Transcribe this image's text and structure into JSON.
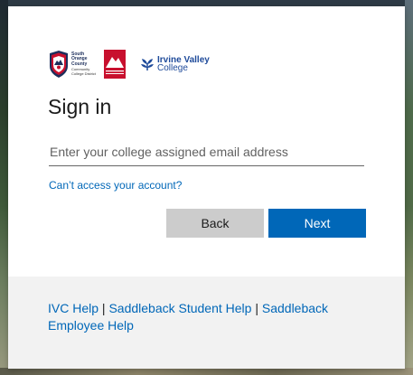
{
  "logos": {
    "socccd": {
      "line1": "South",
      "line2": "Orange",
      "line3": "County",
      "sub1": "Community",
      "sub2": "College District"
    },
    "saddleback": {
      "text": "SADDLEBACK COLLEGE"
    },
    "ivc": {
      "line1": "Irvine Valley",
      "line2": "College"
    }
  },
  "title": "Sign in",
  "email": {
    "value": "",
    "placeholder": "Enter your college assigned email address"
  },
  "cant_access_link": "Can’t access your account?",
  "buttons": {
    "back": "Back",
    "next": "Next"
  },
  "footer": {
    "ivc_help": "IVC Help",
    "separator": "|",
    "saddleback_student_help": "Saddleback Student Help",
    "saddleback_employee_help": "Saddleback Employee Help"
  },
  "colors": {
    "accent": "#0067b8",
    "back_button": "#cccccc",
    "footer_bg": "#f2f2f2"
  }
}
